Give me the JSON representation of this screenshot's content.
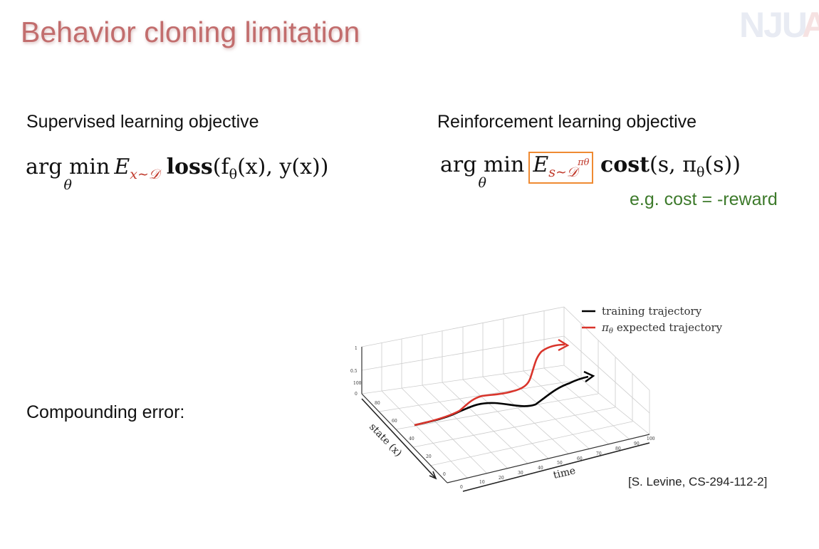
{
  "slide": {
    "title": "Behavior cloning limitation",
    "logo_text": "NJU",
    "supervised": {
      "heading": "Supervised learning objective",
      "op": "arg min",
      "op_sub": "θ",
      "expect_E": "E",
      "expect_sub": "x∼𝒟",
      "rest_bold": "loss",
      "rest": "(f",
      "rest_sub": "θ",
      "rest_tail": "(x), y(x))"
    },
    "reinforcement": {
      "heading": "Reinforcement learning objective",
      "op": "arg min",
      "op_sub": "θ",
      "expect_E": "E",
      "expect_sub": "s∼𝒟",
      "expect_sup": "πθ",
      "rest_bold": "cost",
      "rest": "(s, π",
      "rest_sub": "θ",
      "rest_tail": "(s))",
      "note": "e.g. cost = -reward"
    },
    "compounding_label": "Compounding error:",
    "citation": "[S. Levine, CS-294-112-2]",
    "colors": {
      "title": "#c26d6d",
      "highlight_box": "#ef8a32",
      "note": "#3d7a2b",
      "training_line": "#000000",
      "expected_line": "#d9342b"
    }
  },
  "figure": {
    "legend": {
      "training": "training trajectory",
      "expected_sym": "π",
      "expected_sub": "θ",
      "expected_text": "expected trajectory"
    },
    "xlabel": "time",
    "ylabel": "state (x)",
    "z_ticks": [
      "1",
      "0.5",
      "0"
    ],
    "state_ticks": [
      "100",
      "80",
      "60",
      "40",
      "20",
      "0"
    ],
    "time_ticks": [
      "0",
      "10",
      "20",
      "30",
      "40",
      "50",
      "60",
      "70",
      "80",
      "90",
      "100"
    ]
  }
}
